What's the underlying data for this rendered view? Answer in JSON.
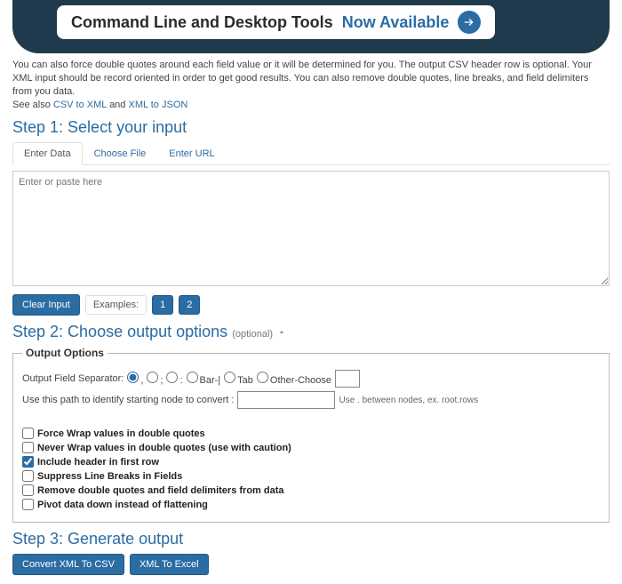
{
  "banner": {
    "text_prefix": "Command Line and Desktop Tools ",
    "text_highlight": "Now Available"
  },
  "intro": {
    "line1": "You can also force double quotes around each field value or it will be determined for you. The output CSV header row is optional. Your XML input should be record oriented in order to get good results. You can also remove double quotes, line breaks, and field delimiters from you data.",
    "see_also": "See also ",
    "link1": "CSV to XML",
    "and": " and ",
    "link2": "XML to JSON"
  },
  "step1": {
    "title": "Step 1: Select your input",
    "tabs": {
      "enter_data": "Enter Data",
      "choose_file": "Choose File",
      "enter_url": "Enter URL"
    },
    "placeholder": "Enter or paste here",
    "clear_btn": "Clear Input",
    "examples_label": "Examples:",
    "ex1": "1",
    "ex2": "2"
  },
  "step2": {
    "title": "Step 2: Choose output options ",
    "optional": "(optional)",
    "legend": "Output Options",
    "sep_label": "Output Field Separator:",
    "sep": {
      "comma": ",",
      "semicolon": ";",
      "colon": ":",
      "bar": "Bar-|",
      "tab": "Tab",
      "other": "Other-Choose"
    },
    "path_label": "Use this path to identify starting node to convert :",
    "path_hint": "Use . between nodes, ex. root.rows",
    "chk": {
      "force_wrap": "Force Wrap values in double quotes",
      "never_wrap": "Never Wrap values in double quotes (use with caution)",
      "include_header": "Include header in first row",
      "suppress_breaks": "Suppress Line Breaks in Fields",
      "remove_quotes": "Remove double quotes and field delimiters from data",
      "pivot": "Pivot data down instead of flattening"
    }
  },
  "step3": {
    "title": "Step 3: Generate output",
    "btn_csv": "Convert XML To CSV",
    "btn_excel": "XML To Excel"
  }
}
